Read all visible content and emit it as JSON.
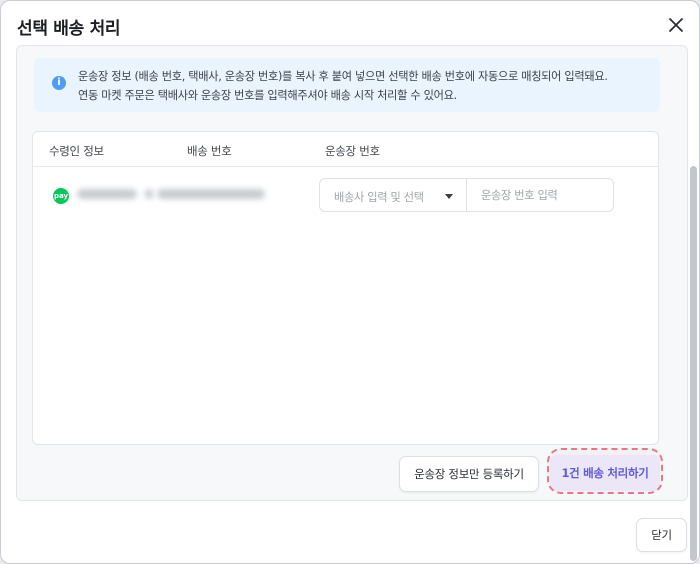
{
  "dialog": {
    "title": "선택 배송 처리",
    "close_icon": "close-icon"
  },
  "info": {
    "icon": "info-icon",
    "line1": "운송장 정보 (배송 번호, 택배사, 운송장 번호)를 복사 후 붙여 넣으면 선택한 배송 번호에 자동으로 매칭되어 입력돼요.",
    "line2": "연동 마켓 주문은 택배사와 운송장 번호를 입력해주셔야 배송 시작 처리할 수 있어요."
  },
  "table": {
    "headers": [
      "수령인 정보",
      "배송 번호",
      "운송장 번호"
    ],
    "rows": [
      {
        "market_icon": "naver-pay-icon",
        "carrier_placeholder": "배송사 입력 및 선택",
        "tracking_placeholder": "운송장 번호 입력"
      }
    ]
  },
  "actions": {
    "register_only": "운송장 정보만 등록하기",
    "process": "1건 배송 처리하기",
    "close": "닫기"
  },
  "colors": {
    "accent": "#5a57e6",
    "info_bg": "#eaf4ff",
    "highlight": "#e07a86"
  }
}
